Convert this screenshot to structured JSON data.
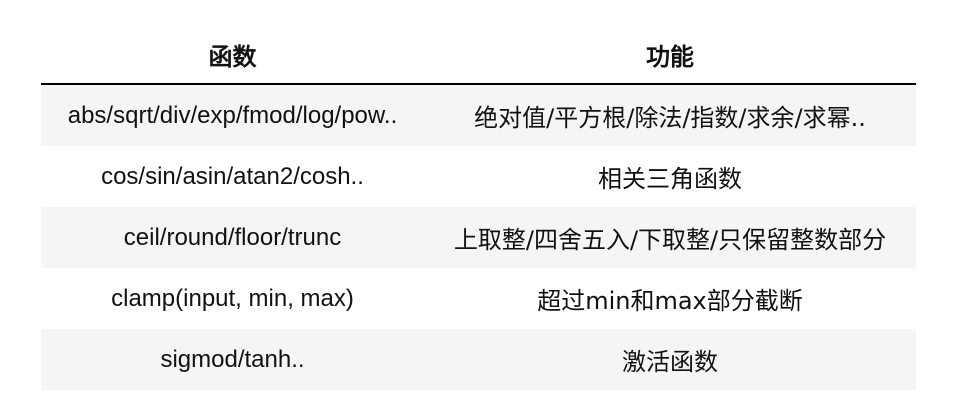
{
  "table": {
    "headers": [
      "函数",
      "功能"
    ],
    "rows": [
      [
        "abs/sqrt/div/exp/fmod/log/pow..",
        "绝对值/平方根/除法/指数/求余/求幂.."
      ],
      [
        "cos/sin/asin/atan2/cosh..",
        "相关三角函数"
      ],
      [
        "ceil/round/floor/trunc",
        "上取整/四舍五入/下取整/只保留整数部分"
      ],
      [
        "clamp(input, min, max)",
        "超过min和max部分截断"
      ],
      [
        "sigmod/tanh..",
        "激活函数"
      ]
    ]
  }
}
